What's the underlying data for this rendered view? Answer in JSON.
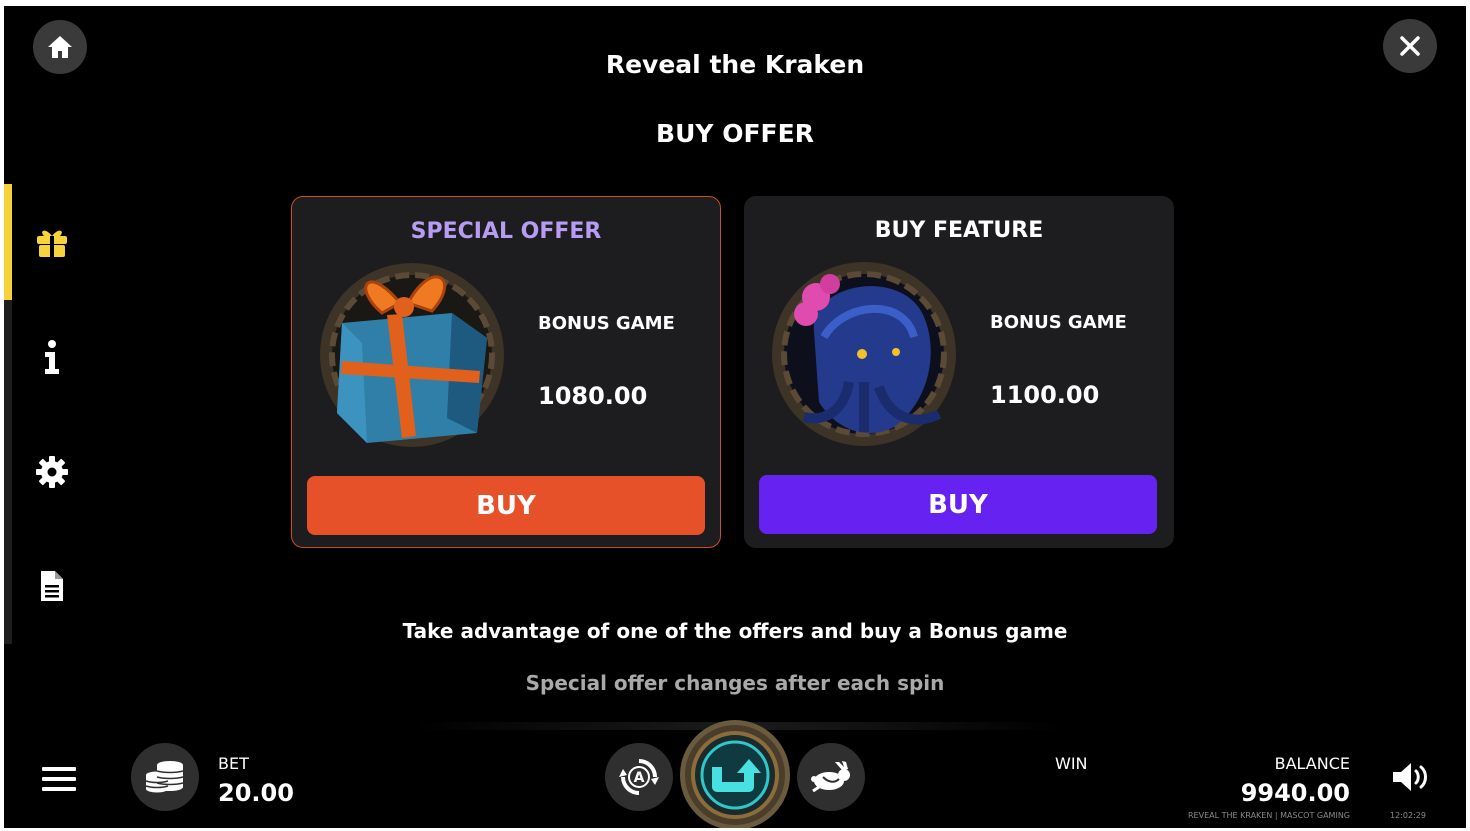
{
  "header": {
    "title": "Reveal the Kraken",
    "section_title": "BUY OFFER"
  },
  "icons": {
    "home": "home-icon",
    "close": "close-icon",
    "sidebar": [
      "gift-icon",
      "info-icon",
      "gear-icon",
      "document-icon"
    ],
    "menu": "hamburger-icon",
    "bet": "coins-icon",
    "autoplay": "autoplay-icon",
    "spin": "spin-icon",
    "turbo": "rabbit-icon",
    "sound": "speaker-icon"
  },
  "offers": [
    {
      "title": "SPECIAL OFFER",
      "label": "BONUS GAME",
      "price": "1080.00",
      "button": "BUY"
    },
    {
      "title": "BUY FEATURE",
      "label": "BONUS GAME",
      "price": "1100.00",
      "button": "BUY"
    }
  ],
  "info": {
    "line1": "Take advantage of one of the offers and buy a Bonus game",
    "line2": "Special offer changes after each spin"
  },
  "bottom_bar": {
    "bet_label": "BET",
    "bet_value": "20.00",
    "win_label": "WIN",
    "balance_label": "BALANCE",
    "balance_value": "9940.00",
    "game_credit": "REVEAL THE KRAKEN | MASCOT GAMING",
    "clock": "12:02:29"
  },
  "colors": {
    "sidebar_active": "#f6d33a",
    "special_title": "#b89cf2",
    "special_buy": "#e6512a",
    "feature_buy": "#6622f0"
  }
}
